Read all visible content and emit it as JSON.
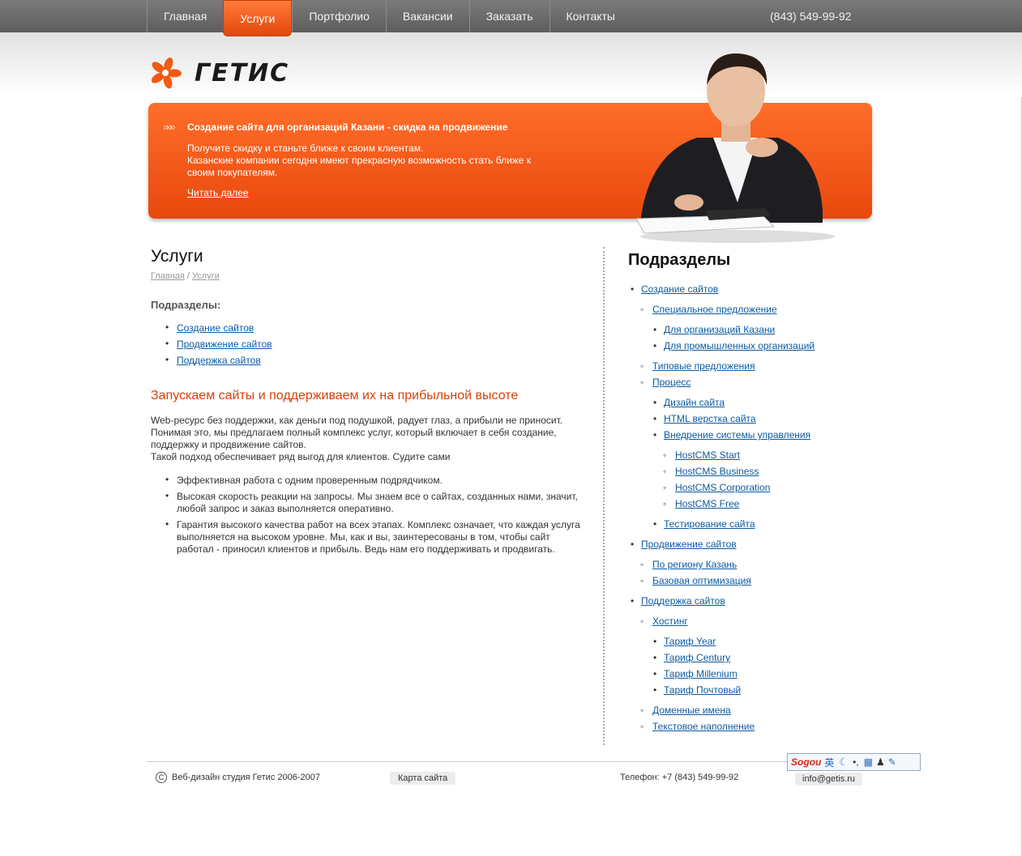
{
  "nav": [
    "Главная",
    "Услуги",
    "Портфолио",
    "Вакансии",
    "Заказать",
    "Контакты"
  ],
  "nav_active": 1,
  "phone_top": "(843) 549-99-92",
  "logo_text": "ГЕТИС",
  "banner": {
    "title": "Создание сайта для организаций Казани - скидка на продвижение",
    "line1": "Получите скидку и станьте ближе к своим клиентам.",
    "line2": "Казанские компании сегодня имеют прекрасную возможность стать ближе к своим покупателям.",
    "link": "Читать далее"
  },
  "main": {
    "title": "Услуги",
    "crumb_home": "Главная",
    "crumb_sep": " / ",
    "crumb_current": "Услуги",
    "sub_head": "Подразделы:",
    "sub_items": [
      "Создание сайтов",
      "Продвижение сайтов",
      "Поддержка сайтов"
    ],
    "h2": "Запускаем сайты и поддерживаем их на прибыльной высоте",
    "para": "Web-ресурс без поддержки, как деньги под подушкой, радует глаз, а прибыли не приносит. Понимая это, мы предлагаем полный комплекс услуг, который включает в себя создание, поддержку и продвижение сайтов.",
    "para2": "Такой подход обеспечивает ряд выгод для клиентов. Судите сами",
    "benefits": [
      "Эффективная работа с одним проверенным подрядчиком.",
      "Высокая скорость реакции на запросы. Мы знаем все о сайтах, созданных нами, значит, любой запрос и заказ выполняется оперативно.",
      "Гарантия высокого качества работ на всех этапах. Комплекс означает, что каждая услуга выполняется на высоком уровне. Мы, как и вы, заинтересованы в том, чтобы сайт работал - приносил клиентов и прибыль. Ведь нам его поддерживать и продвигать."
    ]
  },
  "side": {
    "title": "Подразделы",
    "tree": [
      {
        "label": "Создание сайтов",
        "level": 1
      },
      {
        "label": "Специальное предложение",
        "level": 2,
        "gap": true
      },
      {
        "label": "Для организаций Казани",
        "level": 3,
        "gap": true
      },
      {
        "label": "Для промышленных организаций",
        "level": 3
      },
      {
        "label": "Типовые предложения",
        "level": 2,
        "gap": true
      },
      {
        "label": "Процесс",
        "level": 2
      },
      {
        "label": "Дизайн сайта",
        "level": 3,
        "gap": true
      },
      {
        "label": "HTML верстка сайта",
        "level": 3
      },
      {
        "label": "Внедрение системы управления",
        "level": 3
      },
      {
        "label": "HostCMS Start",
        "level": 4,
        "gap": true
      },
      {
        "label": "HostCMS Business",
        "level": 4
      },
      {
        "label": "HostCMS Corporation",
        "level": 4
      },
      {
        "label": "HostCMS Free",
        "level": 4
      },
      {
        "label": "Тестирование сайта",
        "level": 3,
        "gap": true
      },
      {
        "label": "Продвижение сайтов",
        "level": 1,
        "gap": true
      },
      {
        "label": "По региону Казань",
        "level": 2,
        "gap": true
      },
      {
        "label": "Базовая оптимизация",
        "level": 2
      },
      {
        "label": "Поддержка сайтов",
        "level": 1,
        "gap": true
      },
      {
        "label": "Хостинг",
        "level": 2,
        "gap": true
      },
      {
        "label": "Тариф Year",
        "level": 3,
        "gap": true
      },
      {
        "label": "Тариф Century",
        "level": 3
      },
      {
        "label": "Тариф Millenium",
        "level": 3
      },
      {
        "label": "Тариф Почтовый",
        "level": 3
      },
      {
        "label": "Доменные имена",
        "level": 2,
        "gap": true
      },
      {
        "label": "Текстовое наполнение",
        "level": 2
      }
    ]
  },
  "footer": {
    "copyright": "Веб-дизайн студия Гетис 2006-2007",
    "sitemap": "Карта сайта",
    "phone": "Телефон: +7 (843) 549-99-92",
    "email": "info@getis.ru"
  },
  "ime": {
    "brand": "Sogou",
    "lang": "英"
  },
  "colors": {
    "accent": "#e8480d",
    "link": "#0b5aa3",
    "topbar": "#6a6a6a"
  }
}
